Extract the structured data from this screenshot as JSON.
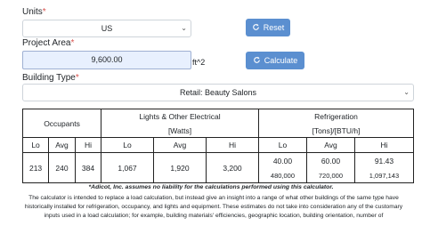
{
  "units": {
    "label": "Units",
    "required_mark": "*",
    "value": "US"
  },
  "project_area": {
    "label": "Project Area",
    "required_mark": "*",
    "value": "9,600.00",
    "unit": "ft^2"
  },
  "buttons": {
    "reset": "Reset",
    "calculate": "Calculate"
  },
  "building_type": {
    "label": "Building Type",
    "required_mark": "*",
    "value": "Retail: Beauty Salons"
  },
  "table": {
    "occupants_header": "Occupants",
    "lights_header": "Lights & Other Electrical",
    "lights_unit": "[Watts]",
    "refrig_header": "Refrigeration",
    "refrig_unit": "[Tons]/[BTU/h]",
    "col_labels": [
      "Lo",
      "Avg",
      "Hi",
      "Lo",
      "Avg",
      "Hi",
      "Lo",
      "Avg",
      "Hi"
    ],
    "occupants": [
      "213",
      "240",
      "384"
    ],
    "lights": [
      "1,067",
      "1,920",
      "3,200"
    ],
    "refrig_tons": [
      "40.00",
      "60.00",
      "91.43"
    ],
    "refrig_btu": [
      "480,000",
      "720,000",
      "1,097,143"
    ]
  },
  "disclaimer": {
    "bold": "*Adicot, Inc. assumes no liability for the calculations performed using this calculator.",
    "body": "The calculator is intended to replace a load calculation, but instead give an insight into a range of what other buildings of the same type have historically installed for refrigeration, occupancy, and lights and equipment. These estimates do not take into consideration any of the customary inputs used in a load calculation; for example, building materials' efficiencies, geographic location, building orientation, number of"
  },
  "colors": {
    "button": "#5b8fd0",
    "input_fill": "#e8f0fe",
    "required": "#d9534f"
  },
  "icons": [
    "refresh-icon",
    "refresh-icon",
    "chevron-down-icon",
    "chevron-down-icon"
  ]
}
